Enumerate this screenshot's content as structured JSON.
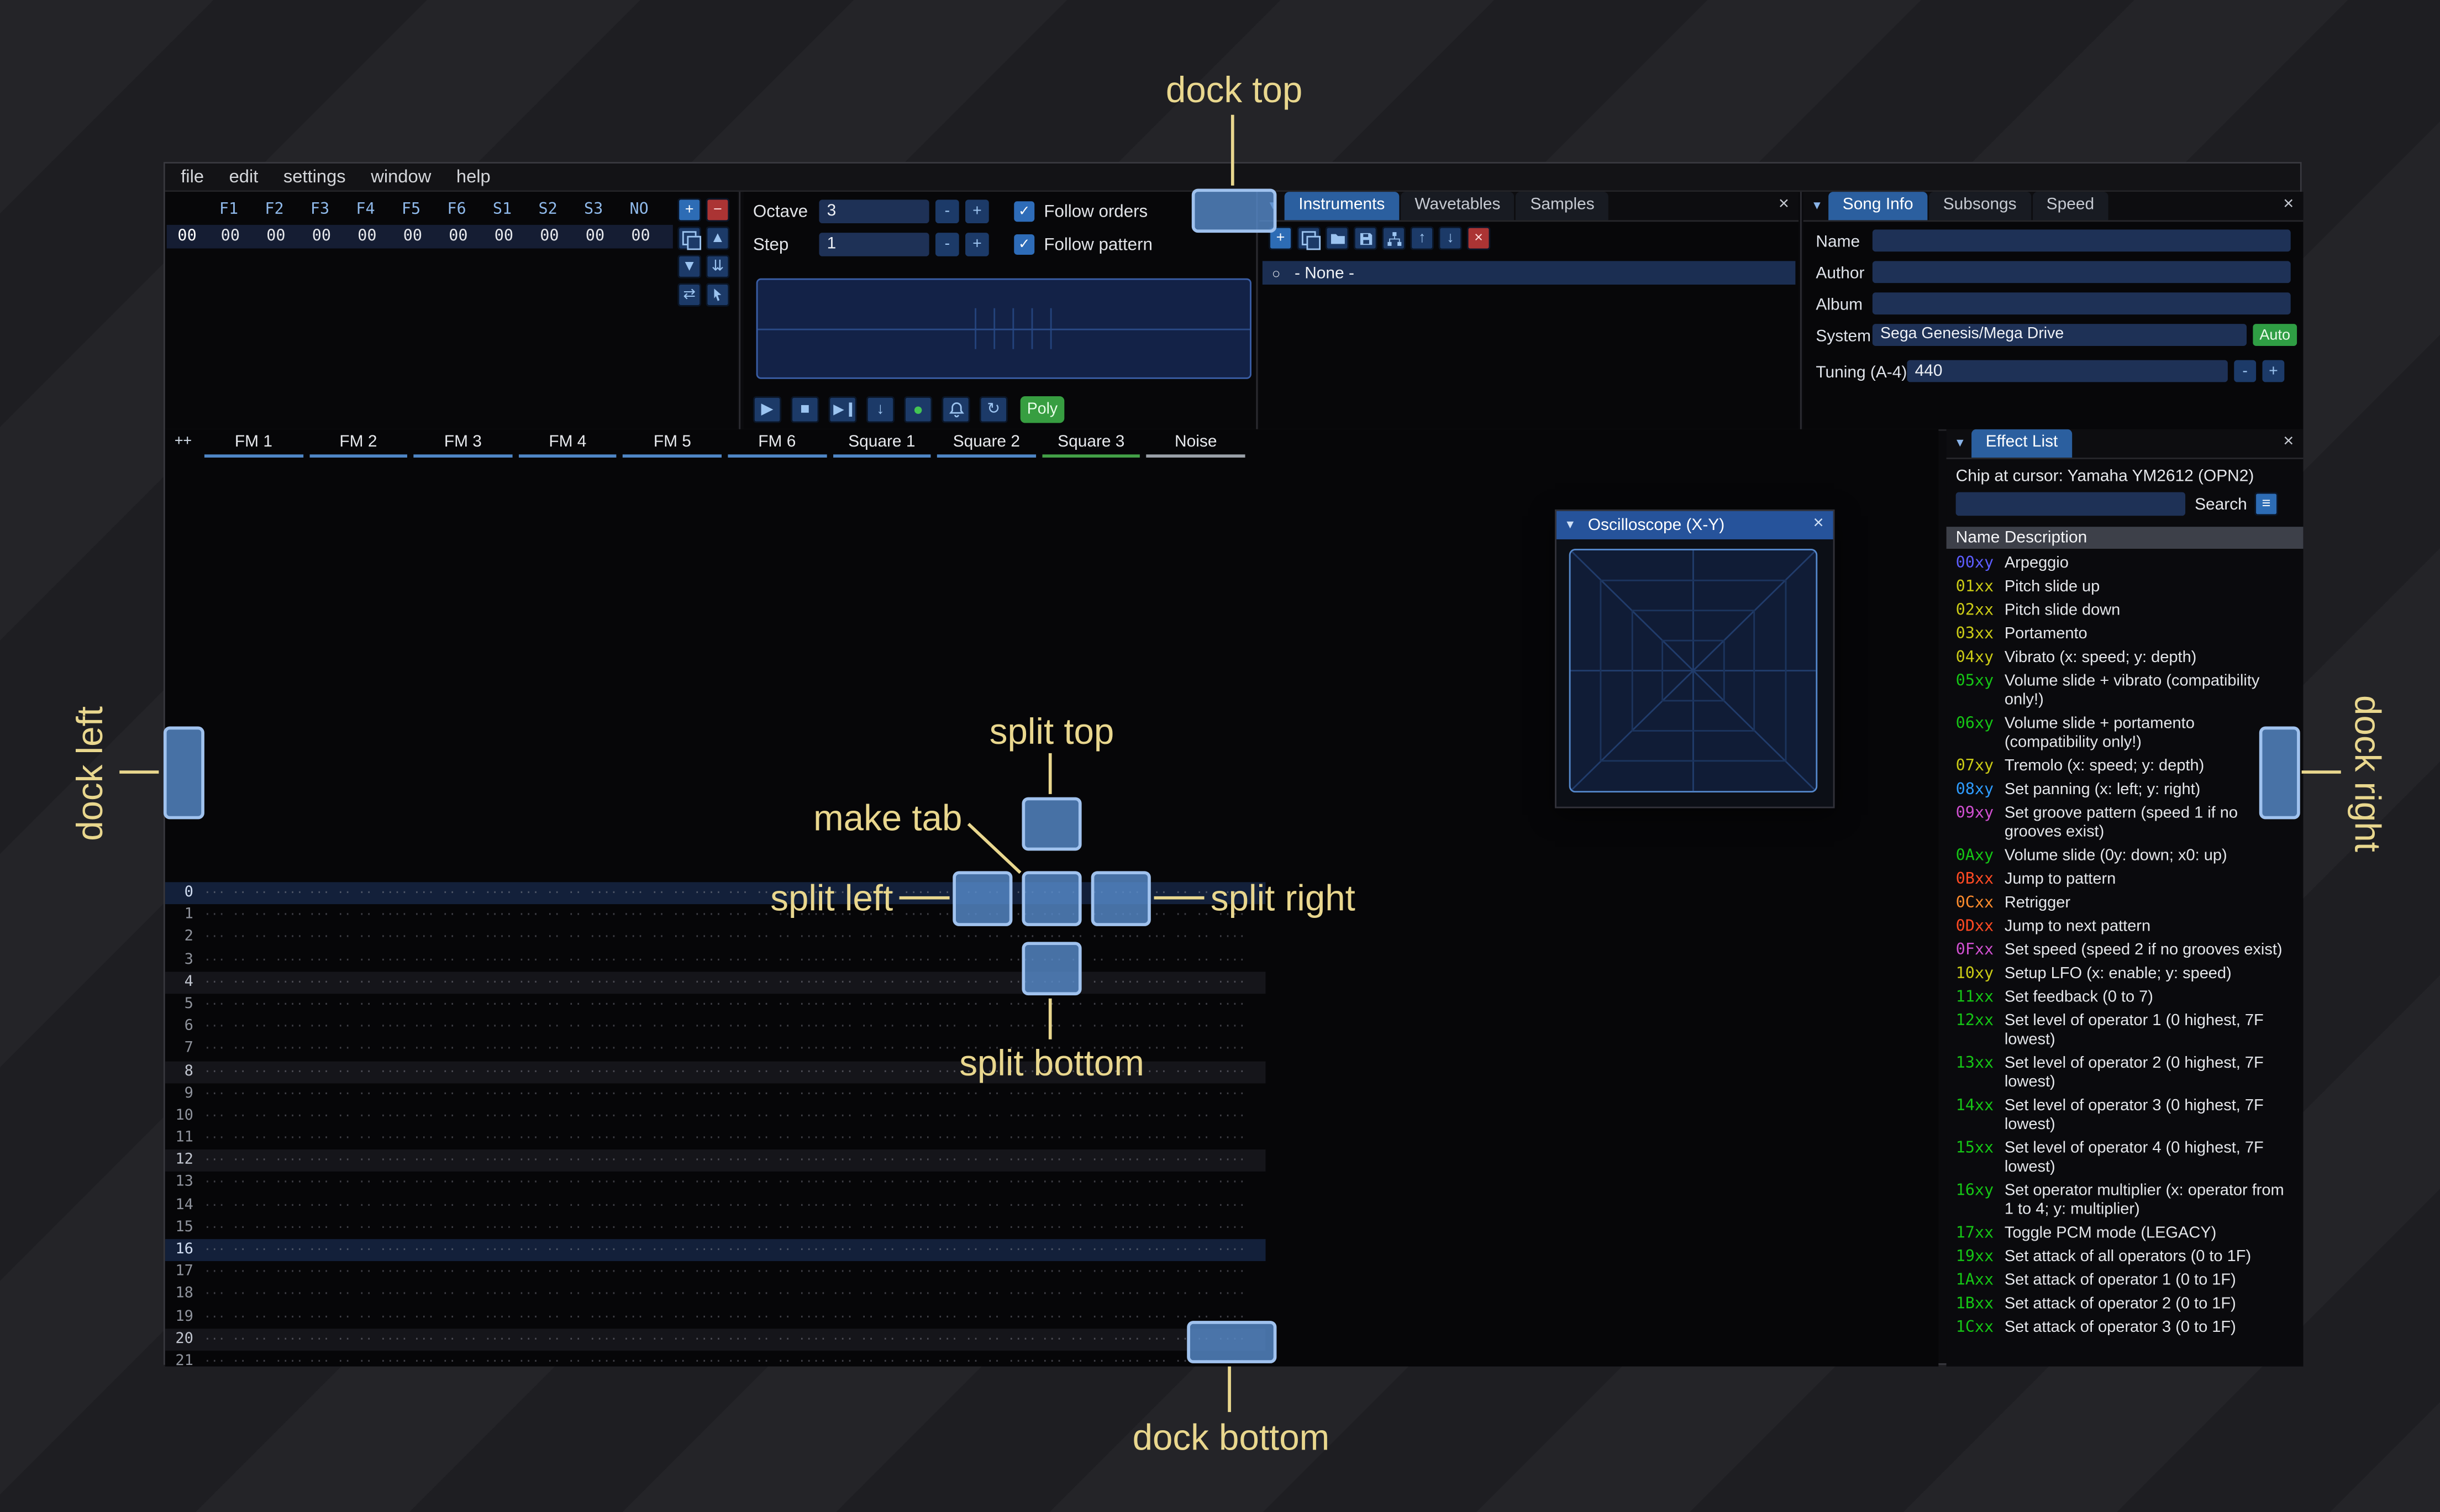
{
  "annotations": {
    "dock_top": "dock top",
    "dock_left": "dock left",
    "dock_right": "dock right",
    "dock_bottom": "dock bottom",
    "split_top": "split top",
    "split_left": "split left",
    "split_right": "split right",
    "split_bottom": "split bottom",
    "make_tab": "make tab"
  },
  "menu_items": [
    "file",
    "edit",
    "settings",
    "window",
    "help"
  ],
  "icons": {
    "collapse": "▼",
    "close": "×",
    "check": "✓",
    "menu": "≡",
    "none_circle": "○"
  },
  "orders": {
    "headers": [
      "F1",
      "F2",
      "F3",
      "F4",
      "F5",
      "F6",
      "S1",
      "S2",
      "S3",
      "NO"
    ],
    "row": {
      "index": "00",
      "values": [
        "00",
        "00",
        "00",
        "00",
        "00",
        "00",
        "00",
        "00",
        "00",
        "00"
      ]
    },
    "buttons": [
      {
        "name": "add-order-button",
        "glyph": "+",
        "variant": "primary"
      },
      {
        "name": "remove-order-button",
        "glyph": "−",
        "variant": "danger"
      },
      {
        "name": "duplicate-order-button",
        "glyph": "clone"
      },
      {
        "name": "move-order-up-button",
        "glyph": "▲"
      },
      {
        "name": "move-order-down-button",
        "glyph": "▼"
      },
      {
        "name": "deep-clone-order-button",
        "glyph": "⇊"
      },
      {
        "name": "change-all-orders-button",
        "glyph": "⇄"
      },
      {
        "name": "order-edit-mode-button",
        "glyph": "cursor"
      }
    ]
  },
  "transport": {
    "octave_label": "Octave",
    "octave_value": "3",
    "step_label": "Step",
    "step_value": "1",
    "dec": "-",
    "inc": "+",
    "follow_orders_label": "Follow orders",
    "follow_pattern_label": "Follow pattern",
    "poly_label": "Poly",
    "buttons": [
      {
        "name": "play-button",
        "glyph": "▶"
      },
      {
        "name": "stop-button",
        "glyph": "■"
      },
      {
        "name": "play-from-cursor-button",
        "glyph": "play-bar"
      },
      {
        "name": "step-one-row-button",
        "glyph": "↓"
      },
      {
        "name": "edit-record-button",
        "glyph": "●",
        "variant": "record"
      },
      {
        "name": "metronome-button",
        "glyph": "bell"
      },
      {
        "name": "repeat-pattern-button",
        "glyph": "↻"
      }
    ]
  },
  "instruments": {
    "tabs": [
      "Instruments",
      "Wavetables",
      "Samples"
    ],
    "active_tab": "Instruments",
    "selected_item": "- None -",
    "toolbar": [
      {
        "name": "add-instrument-button",
        "glyph": "+",
        "variant": "primary"
      },
      {
        "name": "duplicate-instrument-button",
        "glyph": "clone"
      },
      {
        "name": "open-instrument-button",
        "glyph": "folder"
      },
      {
        "name": "save-instrument-button",
        "glyph": "disk"
      },
      {
        "name": "instrument-from-sample-button",
        "glyph": "sitemap"
      },
      {
        "name": "move-instrument-up-button",
        "glyph": "↑"
      },
      {
        "name": "move-instrument-down-button",
        "glyph": "↓"
      },
      {
        "name": "delete-instrument-button",
        "glyph": "×",
        "variant": "danger"
      }
    ]
  },
  "song_info": {
    "tabs": [
      "Song Info",
      "Subsongs",
      "Speed"
    ],
    "active_tab": "Song Info",
    "fields": [
      {
        "label": "Name",
        "value": ""
      },
      {
        "label": "Author",
        "value": ""
      },
      {
        "label": "Album",
        "value": ""
      }
    ],
    "system_label": "System",
    "system_value": "Sega Genesis/Mega Drive",
    "auto_label": "Auto",
    "tuning_label": "Tuning (A-4)",
    "tuning_value": "440",
    "dec": "-",
    "inc": "+"
  },
  "pattern": {
    "expand_label": "++",
    "channels": [
      {
        "name": "FM 1",
        "color": "#4f86c6"
      },
      {
        "name": "FM 2",
        "color": "#4f86c6"
      },
      {
        "name": "FM 3",
        "color": "#4f86c6"
      },
      {
        "name": "FM 4",
        "color": "#4f86c6"
      },
      {
        "name": "FM 5",
        "color": "#4f86c6"
      },
      {
        "name": "FM 6",
        "color": "#4f86c6"
      },
      {
        "name": "Square 1",
        "color": "#4f86c6"
      },
      {
        "name": "Square 2",
        "color": "#4f86c6"
      },
      {
        "name": "Square 3",
        "color": "#43a047"
      },
      {
        "name": "Noise",
        "color": "#9aa0a8"
      }
    ],
    "row_numbers": [
      "0",
      "1",
      "2",
      "3",
      "4",
      "5",
      "6",
      "7",
      "8",
      "9",
      "10",
      "11",
      "12",
      "13",
      "14",
      "15",
      "16",
      "17",
      "18",
      "19",
      "20",
      "21"
    ],
    "hl1_rows": [
      4,
      8,
      12,
      20
    ],
    "hl2_rows": [
      0,
      16
    ],
    "empty_cell": "··· ·· ·· ····"
  },
  "oscilloscope": {
    "title": "Oscilloscope (X-Y)"
  },
  "effect_list": {
    "title": "Effect List",
    "chip_info": "Chip at cursor: Yamaha YM2612 (OPN2)",
    "search_value": "",
    "search_label": "Search",
    "col_name": "Name",
    "col_description": "Description",
    "effects": [
      {
        "code": "00xy",
        "color": "#5d5dff",
        "desc": "Arpeggio"
      },
      {
        "code": "01xx",
        "color": "#cbcb16",
        "desc": "Pitch slide up"
      },
      {
        "code": "02xx",
        "color": "#cbcb16",
        "desc": "Pitch slide down"
      },
      {
        "code": "03xx",
        "color": "#cbcb16",
        "desc": "Portamento"
      },
      {
        "code": "04xy",
        "color": "#cbcb16",
        "desc": "Vibrato (x: speed; y: depth)"
      },
      {
        "code": "05xy",
        "color": "#15c515",
        "desc": "Volume slide + vibrato (compatibility only!)"
      },
      {
        "code": "06xy",
        "color": "#15c515",
        "desc": "Volume slide + portamento (compatibility only!)"
      },
      {
        "code": "07xy",
        "color": "#cbcb16",
        "desc": "Tremolo (x: speed; y: depth)"
      },
      {
        "code": "08xy",
        "color": "#2e9cff",
        "desc": "Set panning (x: left; y: right)"
      },
      {
        "code": "09xy",
        "color": "#d050d0",
        "desc": "Set groove pattern (speed 1 if no grooves exist)"
      },
      {
        "code": "0Axy",
        "color": "#15c515",
        "desc": "Volume slide (0y: down; x0: up)"
      },
      {
        "code": "0Bxx",
        "color": "#ff4a23",
        "desc": "Jump to pattern"
      },
      {
        "code": "0Cxx",
        "color": "#ff8c2d",
        "desc": "Retrigger"
      },
      {
        "code": "0Dxx",
        "color": "#ff4a23",
        "desc": "Jump to next pattern"
      },
      {
        "code": "0Fxx",
        "color": "#d050d0",
        "desc": "Set speed (speed 2 if no grooves exist)"
      },
      {
        "code": "10xy",
        "color": "#cbcb16",
        "desc": "Setup LFO (x: enable; y: speed)"
      },
      {
        "code": "11xx",
        "color": "#15c515",
        "desc": "Set feedback (0 to 7)"
      },
      {
        "code": "12xx",
        "color": "#15c515",
        "desc": "Set level of operator 1 (0 highest, 7F lowest)"
      },
      {
        "code": "13xx",
        "color": "#15c515",
        "desc": "Set level of operator 2 (0 highest, 7F lowest)"
      },
      {
        "code": "14xx",
        "color": "#15c515",
        "desc": "Set level of operator 3 (0 highest, 7F lowest)"
      },
      {
        "code": "15xx",
        "color": "#15c515",
        "desc": "Set level of operator 4 (0 highest, 7F lowest)"
      },
      {
        "code": "16xy",
        "color": "#15c515",
        "desc": "Set operator multiplier (x: operator from 1 to 4; y: multiplier)"
      },
      {
        "code": "17xx",
        "color": "#15c515",
        "desc": "Toggle PCM mode (LEGACY)"
      },
      {
        "code": "19xx",
        "color": "#15c515",
        "desc": "Set attack of all operators (0 to 1F)"
      },
      {
        "code": "1Axx",
        "color": "#15c515",
        "desc": "Set attack of operator 1 (0 to 1F)"
      },
      {
        "code": "1Bxx",
        "color": "#15c515",
        "desc": "Set attack of operator 2 (0 to 1F)"
      },
      {
        "code": "1Cxx",
        "color": "#15c515",
        "desc": "Set attack of operator 3 (0 to 1F)"
      }
    ]
  }
}
